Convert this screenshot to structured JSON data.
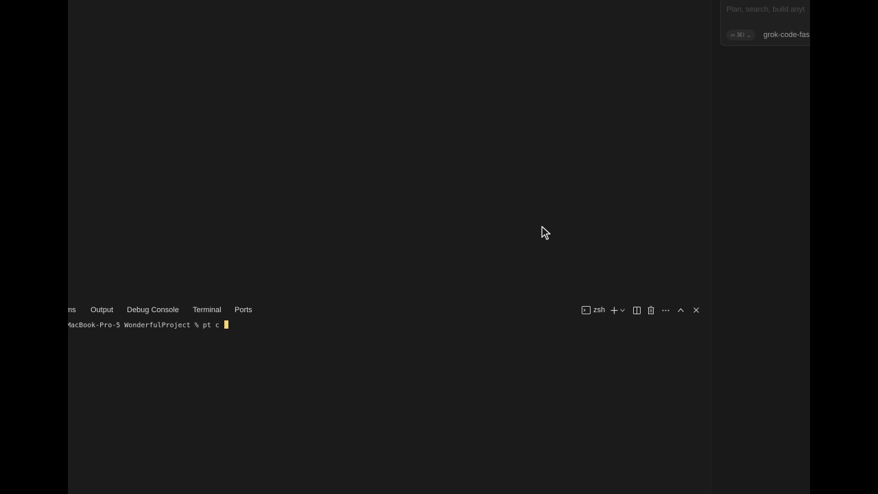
{
  "chat": {
    "placeholder": "Plan, search, build anyt",
    "mode_pill": "∞ ⌘I ⌄",
    "model": "grok-code-fas"
  },
  "panel": {
    "tabs": [
      {
        "label": "ms"
      },
      {
        "label": "Output"
      },
      {
        "label": "Debug Console"
      },
      {
        "label": "Terminal"
      },
      {
        "label": "Ports"
      }
    ],
    "shell_label": "zsh"
  },
  "terminal": {
    "prompt": "MacBook-Pro-5 WonderfulProject % pt c "
  },
  "colors": {
    "background": "#000000",
    "editor": "#1b1b1b",
    "cursor": "#f2d479"
  },
  "icons": [
    "terminal-icon",
    "plus-icon",
    "chevron-down-icon",
    "split-icon",
    "trash-icon",
    "more-icon",
    "chevron-up-icon",
    "close-icon",
    "mouse-pointer-icon"
  ]
}
